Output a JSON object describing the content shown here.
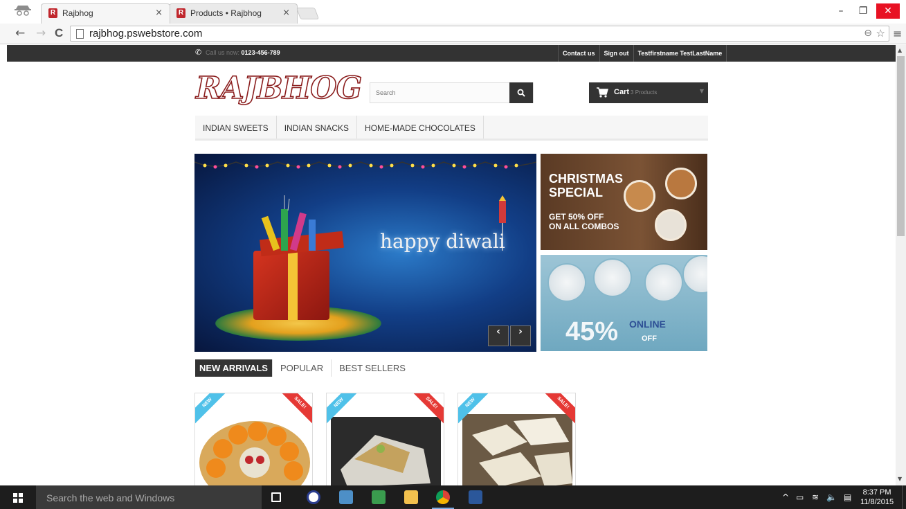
{
  "browser": {
    "tabs": [
      {
        "title": "Rajbhog",
        "favicon": "R",
        "close": "×"
      },
      {
        "title": "Products • Rajbhog",
        "favicon": "R",
        "close": "×"
      }
    ],
    "url": "rajbhog.pswebstore.com",
    "nav": {
      "back": "←",
      "forward": "→",
      "reload": "C"
    },
    "window": {
      "minimize": "–",
      "restore": "❐",
      "close": "✕"
    },
    "menu": "≡",
    "zoom_icon": "⊖",
    "star_icon": "☆"
  },
  "site": {
    "topbar": {
      "call_label": "Call us now:",
      "phone": "0123-456-789",
      "links": [
        "Contact us",
        "Sign out",
        "Testfirstname TestLastName"
      ]
    },
    "logo": "RAJBHOG",
    "search": {
      "placeholder": "Search",
      "button": "🔍"
    },
    "cart": {
      "label": "Cart",
      "count": "3 Products",
      "caret": "▼"
    },
    "menu": [
      "INDIAN SWEETS",
      "INDIAN SNACKS",
      "HOME-MADE CHOCOLATES"
    ],
    "slider": {
      "text": "happy diwali",
      "prev": "‹",
      "next": "›"
    },
    "banner_christmas": {
      "title_line1": "CHRISTMAS",
      "title_line2": "SPECIAL",
      "offer_line1": "GET 50% OFF",
      "offer_line2": "ON ALL COMBOS"
    },
    "banner_online": {
      "percent": "45%",
      "online": "ONLINE",
      "off": "OFF"
    },
    "product_tabs": [
      "NEW ARRIVALS",
      "POPULAR",
      "BEST SELLERS"
    ],
    "products": [
      {
        "new_badge": "NEW",
        "sale_badge": "SALE!"
      },
      {
        "new_badge": "NEW",
        "sale_badge": "SALE!"
      },
      {
        "new_badge": "NEW",
        "sale_badge": "SALE!"
      }
    ]
  },
  "taskbar": {
    "search_placeholder": "Search the web and Windows",
    "time": "8:37 PM",
    "date": "11/8/2015",
    "tray_icons": [
      "^",
      "▭",
      "≋",
      "🔈",
      "▤"
    ]
  },
  "colors": {
    "topbar": "#333333",
    "accent_dark": "#333333",
    "new_badge": "#4fc1e9",
    "sale_badge": "#e53935",
    "logo_stroke": "#8a1c1c",
    "taskbar": "#1d1d1d"
  }
}
